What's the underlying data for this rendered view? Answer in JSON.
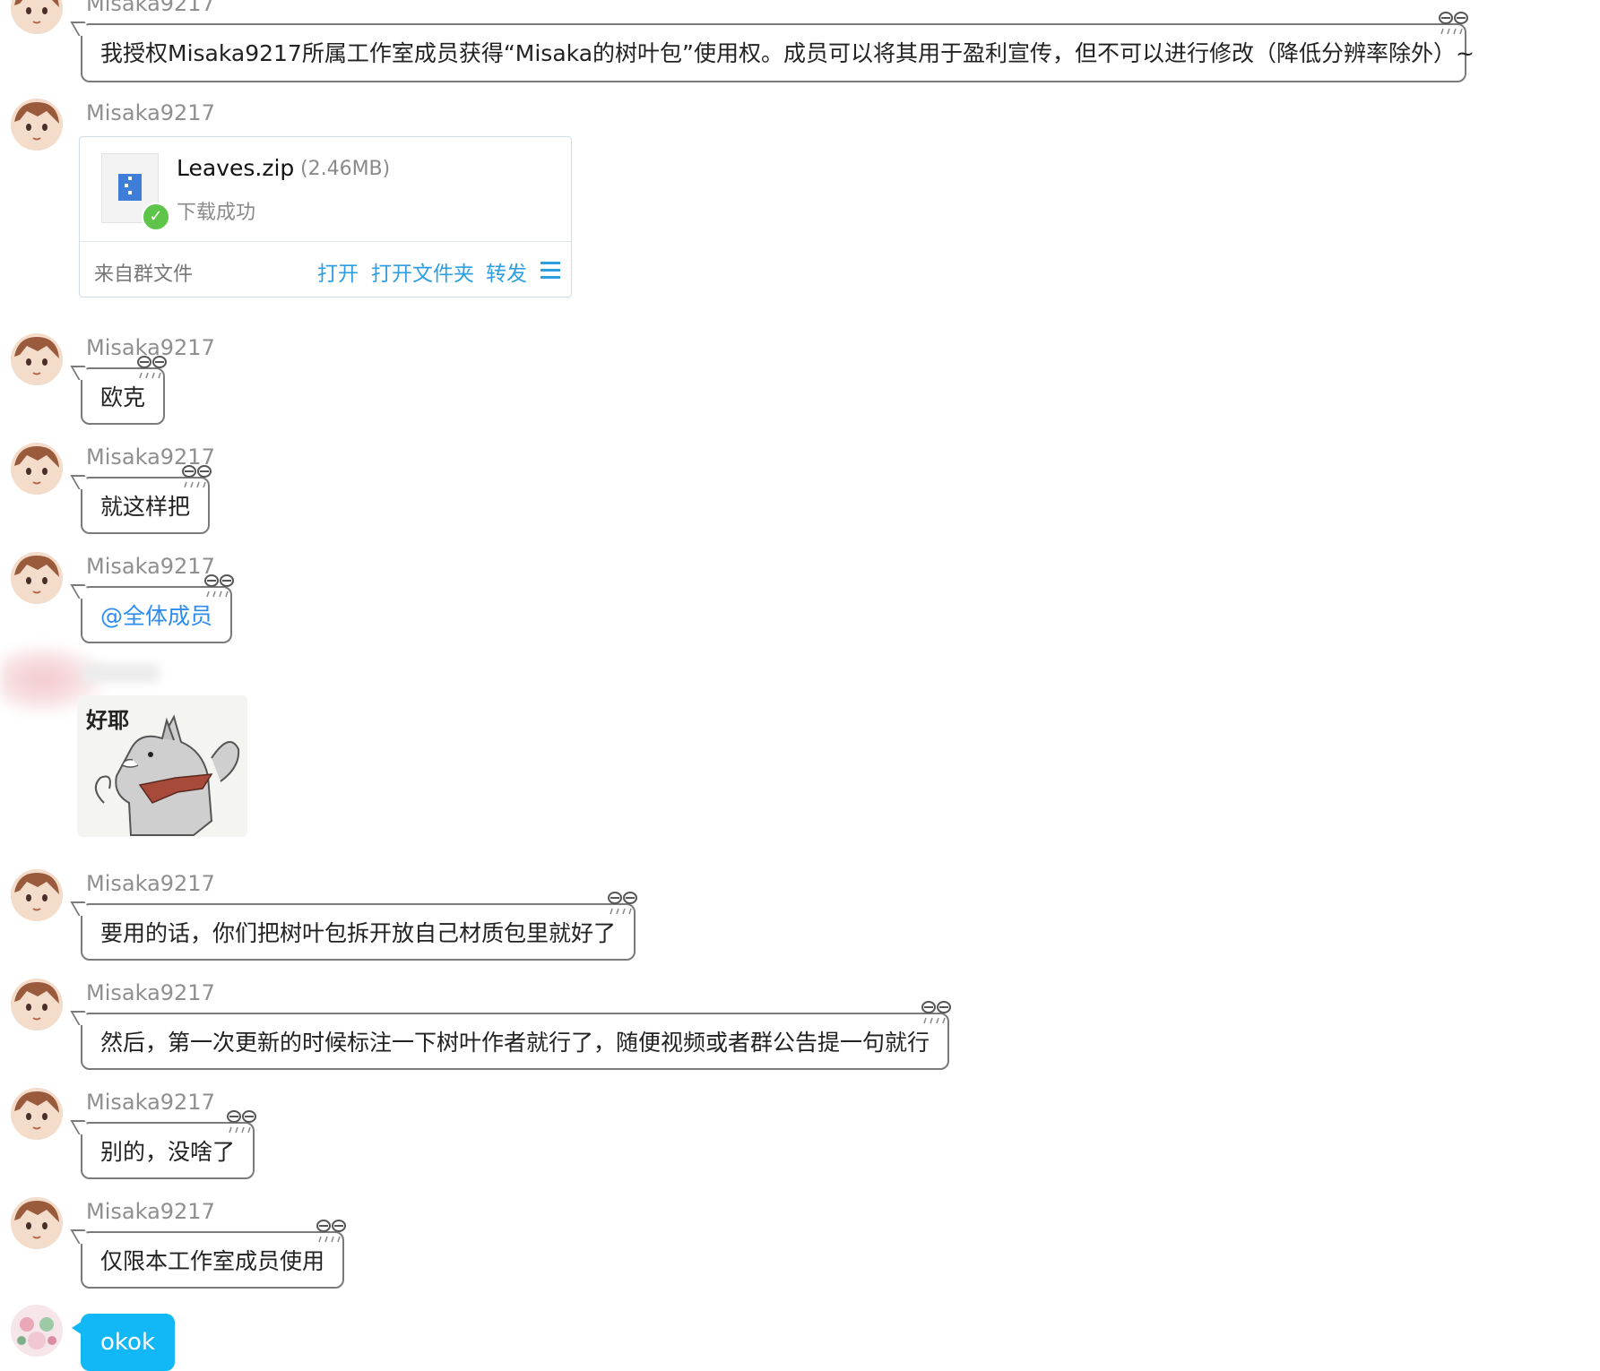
{
  "messages": [
    {
      "sender": "Misaka9217",
      "text": "我授权Misaka9217所属工作室成员获得“Misaka的树叶包”使用权。成员可以将其用于盈利宣传，但不可以进行修改（降低分辨率除外）~"
    },
    {
      "sender": "Misaka9217",
      "type": "file"
    },
    {
      "sender": "Misaka9217",
      "text": "欧克"
    },
    {
      "sender": "Misaka9217",
      "text": "就这样把"
    },
    {
      "sender": "Misaka9217",
      "text": "@全体成员"
    },
    {
      "sender": "Misaka9217",
      "text": "要用的话，你们把树叶包拆开放自己材质包里就好了"
    },
    {
      "sender": "Misaka9217",
      "text": "然后，第一次更新的时候标注一下树叶作者就行了，随便视频或者群公告提一句就行"
    },
    {
      "sender": "Misaka9217",
      "text": "别的，没啥了"
    },
    {
      "sender": "Misaka9217",
      "text": "仅限本工作室成员使用"
    },
    {
      "sender": "",
      "text": "okok"
    }
  ],
  "file": {
    "name": "Leaves.zip",
    "size": "(2.46MB)",
    "status": "下载成功",
    "source": "来自群文件",
    "actions": [
      "打开",
      "打开文件夹",
      "转发"
    ],
    "icon": "zip-file-icon",
    "status_icon": "check-circle-icon",
    "menu_icon": "menu-icon"
  },
  "sticker": {
    "text": "好耶",
    "icon": "shiba-dog-sticker"
  },
  "colors": {
    "self_bubble": "#12b7f5",
    "link": "#2d9fe0",
    "mention": "#2d8cf0",
    "sender_name": "#8f8f8f"
  }
}
